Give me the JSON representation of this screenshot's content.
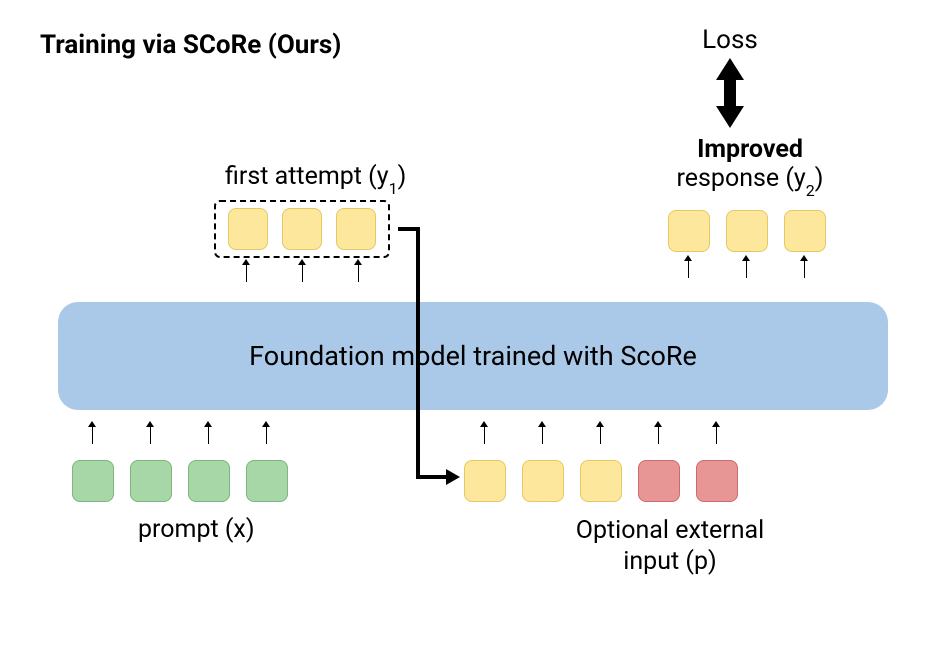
{
  "title": "Training via SCoRe (Ours)",
  "loss_label": "Loss",
  "improved": {
    "line1": "Improved",
    "line2_prefix": "response (y",
    "line2_sub": "2",
    "line2_suffix": ")"
  },
  "first_attempt": {
    "prefix": "first attempt (y",
    "sub": "1",
    "suffix": ")"
  },
  "foundation_label": "Foundation model trained with ScoRe",
  "prompt_label": "prompt (x)",
  "optional_label_line1": "Optional external",
  "optional_label_line2": "input (p)",
  "tokens": {
    "first_attempt_count": 3,
    "improved_count": 3,
    "prompt_count": 4,
    "bottom_yellow_count": 3,
    "bottom_red_count": 2
  }
}
